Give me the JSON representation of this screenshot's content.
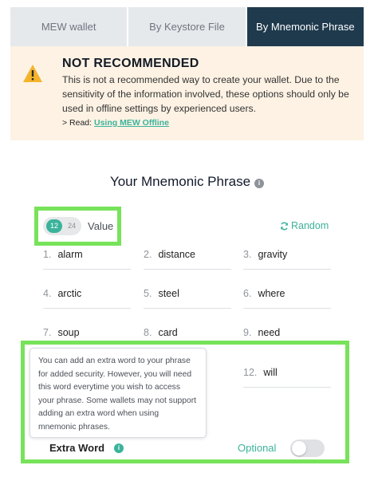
{
  "tabs": [
    {
      "label": "MEW wallet"
    },
    {
      "label": "By Keystore File"
    },
    {
      "label": "By Mnemonic Phrase"
    }
  ],
  "warning": {
    "title": "NOT RECOMMENDED",
    "text": "This is not a recommended way to create your wallet. Due to the sensitivity of the information involved, these options should only be used in offline settings by experienced users.",
    "read_prefix": "> Read: ",
    "read_link": "Using MEW Offline"
  },
  "mnemonic": {
    "title": "Your Mnemonic Phrase",
    "info_glyph": "i",
    "length_options": [
      "12",
      "24"
    ],
    "selected_length": "12",
    "value_label": "Value",
    "random_label": "Random",
    "words": [
      {
        "num": "1.",
        "word": "alarm"
      },
      {
        "num": "2.",
        "word": "distance"
      },
      {
        "num": "3.",
        "word": "gravity"
      },
      {
        "num": "4.",
        "word": "arctic"
      },
      {
        "num": "5.",
        "word": "steel"
      },
      {
        "num": "6.",
        "word": "where"
      },
      {
        "num": "7.",
        "word": "soup"
      },
      {
        "num": "8.",
        "word": "card"
      },
      {
        "num": "9.",
        "word": "need"
      },
      {
        "num": "12.",
        "word": "will"
      }
    ]
  },
  "tooltip": {
    "text": "You can add an extra word to your phrase for added security. However, you will need this word everytime you wish to access your phrase. Some wallets may not support adding an extra word when using mnemonic phrases."
  },
  "extra_word": {
    "label": "Extra Word",
    "info_glyph": "i",
    "optional_label": "Optional",
    "enabled": false
  },
  "colors": {
    "accent": "#3bb39b",
    "active_tab": "#1f3a4d",
    "warning_bg": "#fdf2e4",
    "highlight": "#77e35a"
  }
}
